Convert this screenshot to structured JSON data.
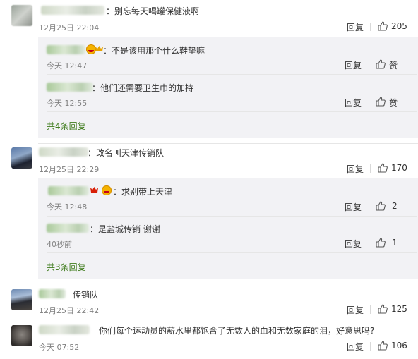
{
  "comments": [
    {
      "text": "：别忘每天喝罐保健液啊",
      "time": "12月25日 22:04",
      "reply_label": "回复",
      "likes": "205",
      "replies": [
        {
          "text": "：不是该用那个什么鞋垫嘛",
          "time": "今天 12:47",
          "reply_label": "回复",
          "likes": "赞"
        },
        {
          "text": "：他们还需要卫生巾的加持",
          "time": "今天 12:55",
          "reply_label": "回复",
          "likes": "赞"
        }
      ],
      "more_label": "共4条回复"
    },
    {
      "text": "：改名叫天津传销队",
      "time": "12月25日 22:29",
      "reply_label": "回复",
      "likes": "170",
      "replies": [
        {
          "text": "：求别带上天津",
          "time": "今天 12:48",
          "reply_label": "回复",
          "likes": "2"
        },
        {
          "text": "：是盐城传销  谢谢",
          "time": "40秒前",
          "reply_label": "回复",
          "likes": "1"
        }
      ],
      "more_label": "共3条回复"
    },
    {
      "text": "传销队",
      "time": "12月25日 22:42",
      "reply_label": "回复",
      "likes": "125"
    },
    {
      "text": "你们每个运动员的薪水里都饱含了无数人的血和无数家庭的泪，好意思吗?",
      "time": "今天 07:52",
      "reply_label": "回复",
      "likes": "106"
    }
  ],
  "icons": {
    "like": "thumbs-up-icon",
    "emoji": "emoji-face-icon",
    "crown": "crown-icon"
  },
  "colors": {
    "link": "#417d1f",
    "reply_bg": "#f2f2f5",
    "muted": "#808080"
  }
}
